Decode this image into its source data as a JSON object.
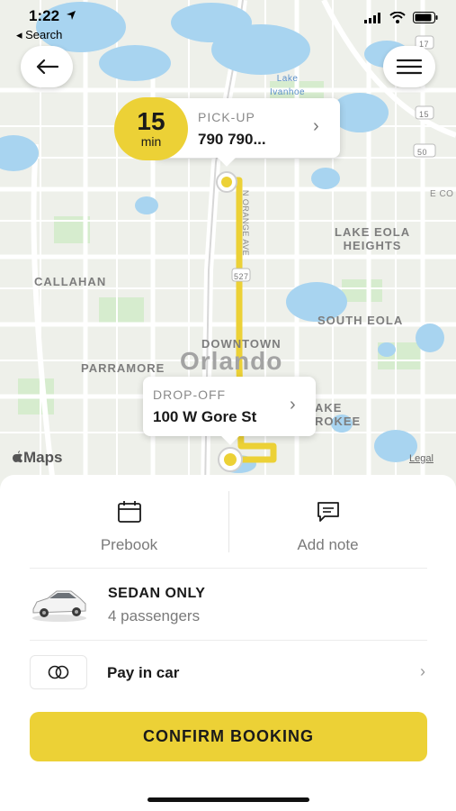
{
  "status_bar": {
    "time": "1:22",
    "back_label": "◂ Search"
  },
  "map": {
    "labels": {
      "lake_ivanhoe": "Lake\nIvanhoe",
      "lake_eola_heights": "LAKE EOLA\nHEIGHTS",
      "callahan": "CALLAHAN",
      "south_eola": "SOUTH EOLA",
      "downtown": "DOWNTOWN",
      "parramore": "PARRAMORE",
      "city": "Orlando",
      "lake_cherokee": "AKE\nROKEE",
      "orange_ave": "N ORANGE AVE",
      "e_co": "E CO",
      "route_527": "527",
      "route_17": "17",
      "route_15": "15",
      "route_50": "50"
    },
    "attribution": "Maps",
    "legal": "Legal"
  },
  "eta": {
    "value": "15",
    "unit": "min"
  },
  "pickup": {
    "caption": "PICK-UP",
    "address": "790 790..."
  },
  "dropoff": {
    "caption": "DROP-OFF",
    "address": "100 W Gore St"
  },
  "actions": {
    "prebook": "Prebook",
    "add_note": "Add note"
  },
  "vehicle": {
    "title": "SEDAN ONLY",
    "subtitle": "4 passengers"
  },
  "payment": {
    "label": "Pay in car"
  },
  "confirm_label": "CONFIRM BOOKING",
  "colors": {
    "accent": "#ecd136",
    "map_water": "#a8d4f0",
    "map_park": "#d6ecce",
    "map_bg": "#eef0ea"
  },
  "icons": {
    "back": "arrow-left-icon",
    "menu": "hamburger-menu-icon",
    "calendar": "calendar-icon",
    "note": "chat-note-icon",
    "car": "sedan-car-icon",
    "pay": "payment-toggle-icon"
  }
}
